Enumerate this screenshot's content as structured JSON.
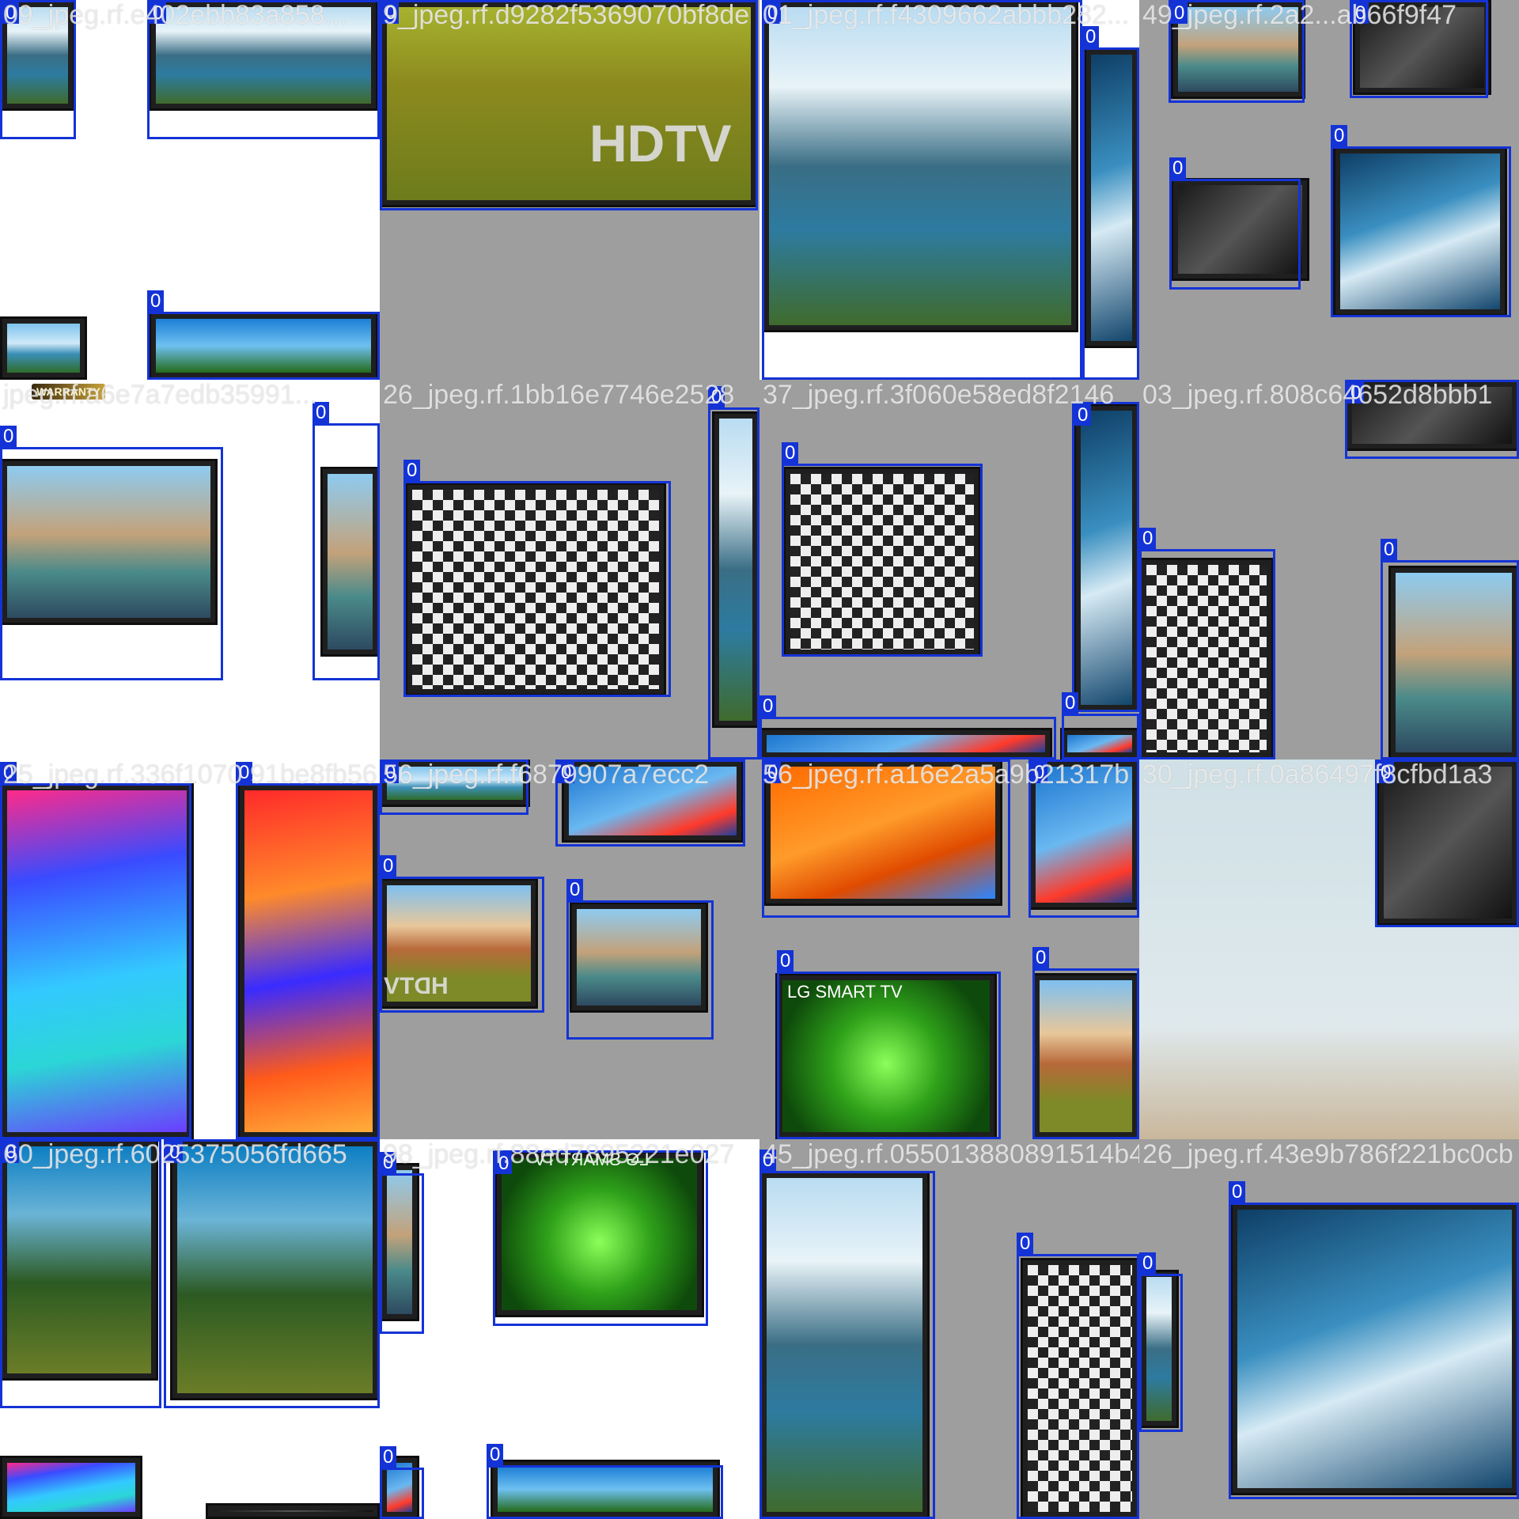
{
  "mosaic": {
    "class_label": "0",
    "bbox_color": "#1433d6",
    "tiles": [
      {
        "name": "tile-1-1",
        "filename": "09_jpeg.rf.e402ebb83a858...",
        "gray": false
      },
      {
        "name": "tile-1-2",
        "filename": "9_jpeg.rf.d9282f5369070bf8de",
        "gray": true
      },
      {
        "name": "tile-1-3",
        "filename": "01_jpeg.rf.f4309662abbb282...",
        "gray": false
      },
      {
        "name": "tile-1-4",
        "filename": "49_jpeg.rf.2a2...ab66f9f47",
        "gray": true
      },
      {
        "name": "tile-2-1",
        "filename": "jpeg.rf.a6e7a7edb35991...",
        "gray": false
      },
      {
        "name": "tile-2-2",
        "filename": "26_jpeg.rf.1bb16e7746e2528",
        "gray": true
      },
      {
        "name": "tile-2-3",
        "filename": "37_jpeg.rf.3f060e58ed8f2146",
        "gray": true
      },
      {
        "name": "tile-2-4",
        "filename": "03_jpeg.rf.808c64652d8bbb1",
        "gray": true
      },
      {
        "name": "tile-3-1",
        "filename": "25_jpeg.rf.336f1070 91be8fb56",
        "gray": false
      },
      {
        "name": "tile-3-2",
        "filename": "56_jpeg.rf.f6879907a7ecc2",
        "gray": true
      },
      {
        "name": "tile-3-3",
        "filename": "56_jpeg.rf.a16e2a5a9b21317b",
        "gray": true
      },
      {
        "name": "tile-3-4",
        "filename": "30_jpeg.rf.0a86497f8cfbd1a3",
        "gray": false
      },
      {
        "name": "tile-4-1",
        "filename": "60_jpeg.rf.6025375056fd665",
        "gray": false
      },
      {
        "name": "tile-4-2",
        "filename": "98_jpeg.rf.88ed7895221e027",
        "gray": false
      },
      {
        "name": "tile-4-3",
        "filename": "45_jpeg.rf.055013880891514b4",
        "gray": true
      },
      {
        "name": "tile-4-4",
        "filename": "26_jpeg.rf.43e9b786f221bc0cb",
        "gray": true
      }
    ],
    "overlay_text": {
      "hdtv_large": "HDTV",
      "hdtv_small": "HDTV",
      "lg_smart_tv": "LG SMART TV",
      "lg_smart_tv_mirrored": "LG SMART TV",
      "warranty": "WARRANTY"
    }
  }
}
